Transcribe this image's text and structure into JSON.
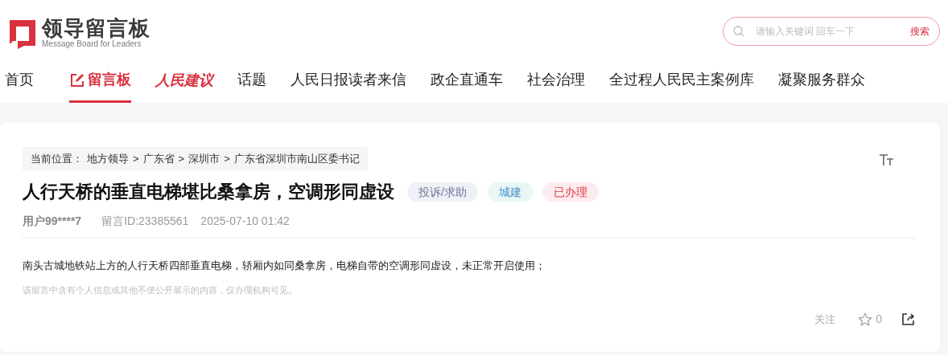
{
  "logo": {
    "title": "领导留言板",
    "subtitle": "Message Board for Leaders"
  },
  "search": {
    "placeholder": "请输入关键词 回车一下",
    "button": "搜索"
  },
  "nav": [
    {
      "label": "首页",
      "kind": "plain",
      "selected": false
    },
    {
      "label": "留言板",
      "kind": "icon",
      "selected": true
    },
    {
      "label": "人民建议",
      "kind": "calligraphy",
      "selected": false
    },
    {
      "label": "话题",
      "kind": "plain",
      "selected": false
    },
    {
      "label": "人民日报读者来信",
      "kind": "plain",
      "selected": false
    },
    {
      "label": "政企直通车",
      "kind": "plain",
      "selected": false
    },
    {
      "label": "社会治理",
      "kind": "plain",
      "selected": false
    },
    {
      "label": "全过程人民民主案例库",
      "kind": "plain",
      "selected": false
    },
    {
      "label": "凝聚服务群众",
      "kind": "plain",
      "selected": false
    }
  ],
  "breadcrumb": {
    "label": "当前位置：",
    "items": [
      "地方领导",
      "广东省",
      "深圳市",
      "广东省深圳市南山区委书记"
    ],
    "separator": ">"
  },
  "message": {
    "title": "人行天桥的垂直电梯堪比桑拿房，空调形同虚设",
    "tags": [
      {
        "label": "投诉/求助",
        "color": "#eef1f7"
      },
      {
        "label": "城建",
        "color": "#e8f7f6"
      },
      {
        "label": "已办理",
        "color": "#fdecee"
      }
    ],
    "user": "用户99****7",
    "id": "留言ID:23385561",
    "time": "2025-07-10 01:42",
    "body": "南头古城地铁站上方的人行天桥四部垂直电梯，轿厢内如同桑拿房，电梯自带的空调形同虚设，未正常开启使用；",
    "notice": "该留言中含有个人信息或其他不便公开展示的内容，仅办理机构可见。",
    "follow": "关注",
    "likes": "0"
  }
}
